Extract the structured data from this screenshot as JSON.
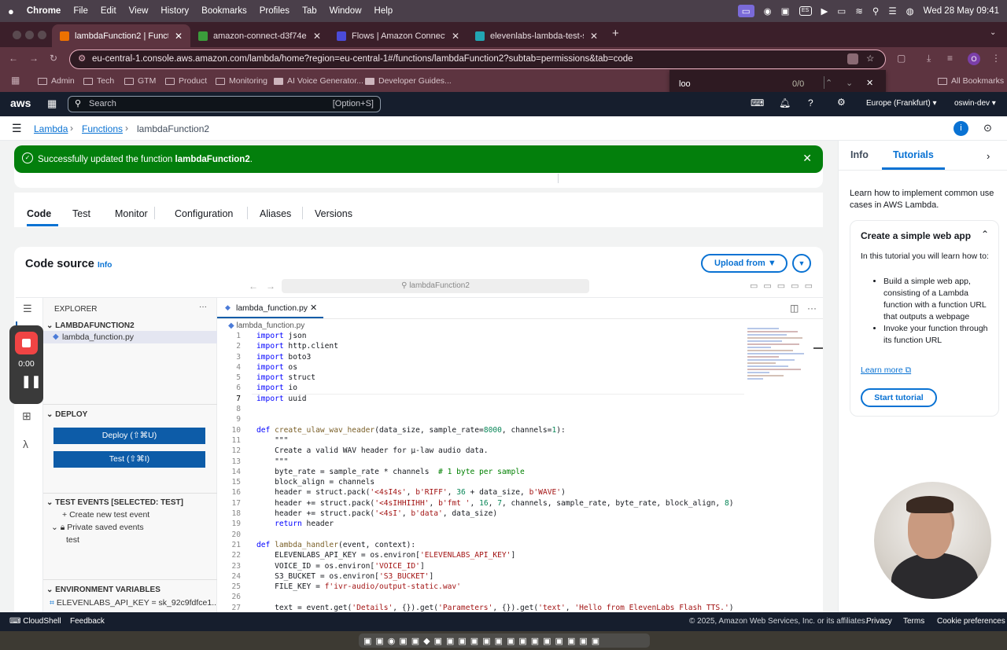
{
  "mac_menu": {
    "apple": "",
    "items": [
      "Chrome",
      "File",
      "Edit",
      "View",
      "History",
      "Bookmarks",
      "Profiles",
      "Tab",
      "Window",
      "Help"
    ],
    "input_source": "ES",
    "datetime": "Wed 28 May  09:41"
  },
  "browser": {
    "tabs": [
      {
        "label": "lambdaFunction2 | Functions",
        "color": "#ed7100"
      },
      {
        "label": "amazon-connect-d3f74e0be",
        "color": "#3b9c3b"
      },
      {
        "label": "Flows | Amazon Connect | eu",
        "color": "#4b4bd8"
      },
      {
        "label": "elevenlabs-lambda-test-s3",
        "color": "#22a5b3"
      }
    ],
    "url": "eu-central-1.console.aws.amazon.com/lambda/home?region=eu-central-1#/functions/lambdaFunction2?subtab=permissions&tab=code",
    "profile_initial": "O",
    "bookmarks": [
      "Admin",
      "Tech",
      "GTM",
      "Product",
      "Monitoring",
      "AI Voice Generator...",
      "Developer Guides..."
    ],
    "all_bookmarks": "All Bookmarks",
    "find": {
      "query": "loo",
      "count": "0/0"
    }
  },
  "aws": {
    "logo": "aws",
    "search_placeholder": "Search",
    "search_shortcut": "[Option+S]",
    "region": "Europe (Frankfurt)",
    "account": "oswin-dev"
  },
  "breadcrumb": [
    "Lambda",
    "Functions",
    "lambdaFunction2"
  ],
  "flash": {
    "prefix": "Successfully updated the function ",
    "name": "lambdaFunction2",
    "suffix": "."
  },
  "recorder": {
    "time": "0:00"
  },
  "function_tabs": [
    "Code",
    "Test",
    "Monitor",
    "Configuration",
    "Aliases",
    "Versions"
  ],
  "code_source": {
    "title": "Code source",
    "info": "Info",
    "upload": "Upload from",
    "command_center": "lambdaFunction2"
  },
  "explorer": {
    "title": "EXPLORER",
    "folder": "LAMBDAFUNCTION2",
    "file": "lambda_function.py",
    "deploy_title": "DEPLOY",
    "deploy_btn": "Deploy (⇧⌘U)",
    "test_btn": "Test (⇧⌘I)",
    "test_events_title": "TEST EVENTS [SELECTED: TEST]",
    "create_event": "Create new test event",
    "private_events": "Private saved events",
    "event_test": "test",
    "env_title": "ENVIRONMENT VARIABLES",
    "env_var": "ELEVENLABS_API_KEY = sk_92c9fdfce1..."
  },
  "editor": {
    "tab": "lambda_function.py",
    "breadcrumb": "lambda_function.py",
    "lines": [
      {
        "n": "1",
        "t": "import json"
      },
      {
        "n": "2",
        "t": "import http.client"
      },
      {
        "n": "3",
        "t": "import boto3"
      },
      {
        "n": "4",
        "t": "import os"
      },
      {
        "n": "5",
        "t": "import struct"
      },
      {
        "n": "6",
        "t": "import io"
      },
      {
        "n": "7",
        "t": "import uuid"
      },
      {
        "n": "8",
        "t": ""
      },
      {
        "n": "9",
        "t": ""
      },
      {
        "n": "10",
        "t": "def create_ulaw_wav_header(data_size, sample_rate=8000, channels=1):"
      },
      {
        "n": "11",
        "t": "    \"\"\""
      },
      {
        "n": "12",
        "t": "    Create a valid WAV header for μ-law audio data."
      },
      {
        "n": "13",
        "t": "    \"\"\""
      },
      {
        "n": "14",
        "t": "    byte_rate = sample_rate * channels  # 1 byte per sample"
      },
      {
        "n": "15",
        "t": "    block_align = channels"
      },
      {
        "n": "16",
        "t": "    header = struct.pack('<4sI4s', b'RIFF', 36 + data_size, b'WAVE')"
      },
      {
        "n": "17",
        "t": "    header += struct.pack('<4sIHHIIHH', b'fmt ', 16, 7, channels, sample_rate, byte_rate, block_align, 8)"
      },
      {
        "n": "18",
        "t": "    header += struct.pack('<4sI', b'data', data_size)"
      },
      {
        "n": "19",
        "t": "    return header"
      },
      {
        "n": "20",
        "t": ""
      },
      {
        "n": "21",
        "t": "def lambda_handler(event, context):"
      },
      {
        "n": "22",
        "t": "    ELEVENLABS_API_KEY = os.environ['ELEVENLABS_API_KEY']"
      },
      {
        "n": "23",
        "t": "    VOICE_ID = os.environ['VOICE_ID']"
      },
      {
        "n": "24",
        "t": "    S3_BUCKET = os.environ['S3_BUCKET']"
      },
      {
        "n": "25",
        "t": "    FILE_KEY = f'ivr-audio/output-static.wav'"
      },
      {
        "n": "26",
        "t": ""
      },
      {
        "n": "27",
        "t": "    text = event.get('Details', {}).get('Parameters', {}).get('text', 'Hello from ElevenLabs Flash TTS.')"
      }
    ]
  },
  "right_panel": {
    "tabs": [
      "Info",
      "Tutorials"
    ],
    "intro": "Learn how to implement common use cases in AWS Lambda.",
    "tutorial_title": "Create a simple web app",
    "tutorial_desc": "In this tutorial you will learn how to:",
    "bullets": [
      "Build a simple web app, consisting of a Lambda function with a function URL that outputs a webpage",
      "Invoke your function through its function URL"
    ],
    "learn_more": "Learn more",
    "start": "Start tutorial"
  },
  "footer": {
    "cloudshell": "CloudShell",
    "feedback": "Feedback",
    "copyright": "© 2025, Amazon Web Services, Inc. or its affiliates.",
    "links": [
      "Privacy",
      "Terms",
      "Cookie preferences"
    ]
  }
}
